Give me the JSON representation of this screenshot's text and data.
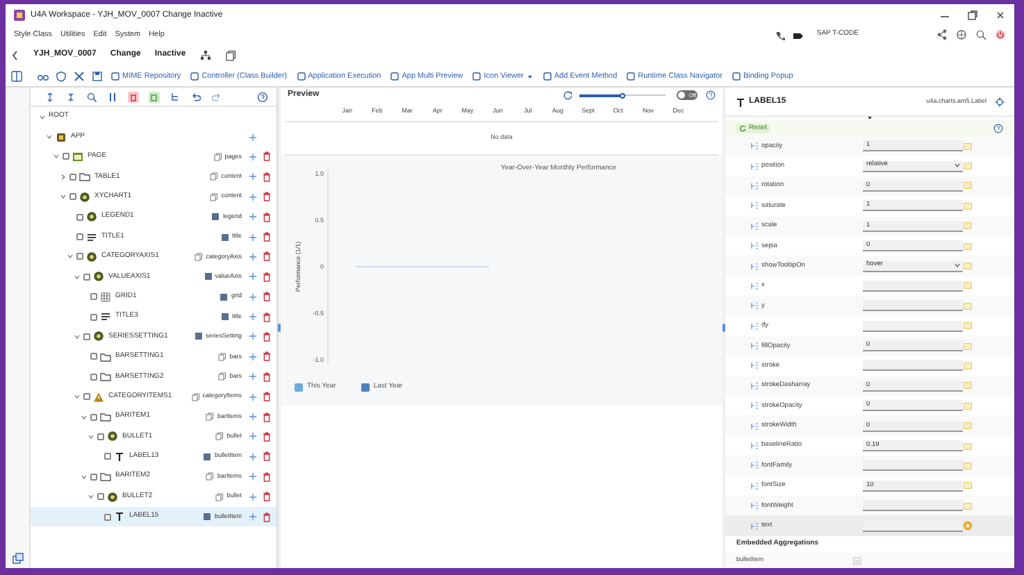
{
  "window": {
    "title": "U4A Workspace - YJH_MOV_0007 Change Inactive"
  },
  "menu": [
    "Style Class",
    "Utilities",
    "Edit",
    "System",
    "Help"
  ],
  "tcode": "SAP T-CODE",
  "app_header": {
    "name": "YJH_MOV_0007",
    "mode": "Change",
    "status": "Inactive"
  },
  "toolbar": [
    {
      "label": "MIME Repository"
    },
    {
      "label": "Controller (Class Builder)"
    },
    {
      "label": "Application Execution"
    },
    {
      "label": "App Multi Preview"
    },
    {
      "label": "Icon Viewer",
      "has_menu": true
    },
    {
      "label": "Add Event Method"
    },
    {
      "label": "Runtime Class Navigator"
    },
    {
      "label": "Binding Popup"
    }
  ],
  "tree": [
    {
      "label": "ROOT",
      "expanded": true,
      "addable": false,
      "deletable": false,
      "selected": false,
      "children": [
        {
          "label": "APP",
          "kind": "app",
          "expanded": true,
          "addable": true,
          "deletable": false,
          "selected": false,
          "children": [
            {
              "label": "PAGE",
              "kind": "page",
              "aggregation": "pages",
              "multiple": true,
              "expanded": true,
              "checked": false,
              "addable": true,
              "deletable": true,
              "selected": false,
              "children": [
                {
                  "label": "TABLE1",
                  "kind": "folder",
                  "aggregation": "content",
                  "multiple": true,
                  "expanded": false,
                  "checked": false,
                  "addable": true,
                  "deletable": true,
                  "selected": false
                },
                {
                  "label": "XYCHART1",
                  "kind": "chart",
                  "aggregation": "content",
                  "multiple": true,
                  "expanded": true,
                  "checked": false,
                  "addable": true,
                  "deletable": true,
                  "selected": false,
                  "children": [
                    {
                      "label": "LEGEND1",
                      "kind": "chart",
                      "aggregation": "legend",
                      "multiple": false,
                      "checked": false,
                      "addable": true,
                      "deletable": true,
                      "selected": false
                    },
                    {
                      "label": "TITLE1",
                      "kind": "title",
                      "aggregation": "title",
                      "multiple": false,
                      "checked": false,
                      "addable": true,
                      "deletable": true,
                      "selected": false
                    },
                    {
                      "label": "CATEGORYAXIS1",
                      "kind": "chart",
                      "aggregation": "categoryAxis",
                      "multiple": true,
                      "expanded": true,
                      "checked": false,
                      "addable": true,
                      "deletable": true,
                      "selected": false,
                      "children": [
                        {
                          "label": "VALUEAXIS1",
                          "kind": "chart",
                          "aggregation": "valueAxis",
                          "multiple": false,
                          "expanded": true,
                          "checked": false,
                          "addable": true,
                          "deletable": true,
                          "selected": false,
                          "children": [
                            {
                              "label": "GRID1",
                              "kind": "grid",
                              "aggregation": "grid",
                              "multiple": false,
                              "checked": false,
                              "addable": true,
                              "deletable": true,
                              "selected": false
                            },
                            {
                              "label": "TITLE3",
                              "kind": "title",
                              "aggregation": "title",
                              "multiple": false,
                              "checked": false,
                              "addable": true,
                              "deletable": true,
                              "selected": false
                            }
                          ]
                        },
                        {
                          "label": "SERIESSETTING1",
                          "kind": "chart",
                          "aggregation": "seriesSetting",
                          "multiple": false,
                          "expanded": true,
                          "checked": false,
                          "addable": true,
                          "deletable": true,
                          "selected": false,
                          "children": [
                            {
                              "label": "BARSETTING1",
                              "kind": "folder",
                              "aggregation": "bars",
                              "multiple": true,
                              "checked": false,
                              "addable": true,
                              "deletable": true,
                              "selected": false
                            },
                            {
                              "label": "BARSETTING2",
                              "kind": "folder",
                              "aggregation": "bars",
                              "multiple": true,
                              "checked": false,
                              "addable": true,
                              "deletable": true,
                              "selected": false
                            }
                          ]
                        },
                        {
                          "label": "CATEGORYITEMS1",
                          "kind": "warning",
                          "aggregation": "categoryItems",
                          "multiple": true,
                          "expanded": true,
                          "checked": false,
                          "addable": true,
                          "deletable": true,
                          "selected": false,
                          "children": [
                            {
                              "label": "BARITEM1",
                              "kind": "folder",
                              "aggregation": "barItems",
                              "multiple": true,
                              "expanded": true,
                              "checked": false,
                              "addable": true,
                              "deletable": true,
                              "selected": false,
                              "children": [
                                {
                                  "label": "BULLET1",
                                  "kind": "chart",
                                  "aggregation": "bullet",
                                  "multiple": true,
                                  "expanded": true,
                                  "checked": false,
                                  "addable": true,
                                  "deletable": true,
                                  "selected": false,
                                  "children": [
                                    {
                                      "label": "LABEL13",
                                      "kind": "label",
                                      "aggregation": "bulletItem",
                                      "multiple": false,
                                      "checked": false,
                                      "addable": true,
                                      "deletable": true,
                                      "selected": false
                                    }
                                  ]
                                }
                              ]
                            },
                            {
                              "label": "BARITEM2",
                              "kind": "folder",
                              "aggregation": "barItems",
                              "multiple": true,
                              "expanded": true,
                              "checked": false,
                              "addable": true,
                              "deletable": true,
                              "selected": false,
                              "children": [
                                {
                                  "label": "BULLET2",
                                  "kind": "chart",
                                  "aggregation": "bullet",
                                  "multiple": true,
                                  "expanded": true,
                                  "checked": false,
                                  "addable": true,
                                  "deletable": true,
                                  "selected": false,
                                  "children": [
                                    {
                                      "label": "LABEL15",
                                      "kind": "label",
                                      "aggregation": "bulletItem",
                                      "multiple": false,
                                      "checked": false,
                                      "addable": true,
                                      "deletable": true,
                                      "selected": true
                                    }
                                  ]
                                }
                              ]
                            }
                          ]
                        }
                      ]
                    }
                  ]
                }
              ]
            }
          ]
        }
      ]
    }
  ],
  "preview": {
    "title": "Preview",
    "slider": {
      "level": 0.5
    },
    "toggle": {
      "label": "Off",
      "on": false
    },
    "months": [
      "Jan",
      "Feb",
      "Mar",
      "Apr",
      "May",
      "Jun",
      "Jul",
      "Aug",
      "Sept",
      "Oct",
      "Nov",
      "Dec"
    ],
    "no_data": "No data",
    "chart": {
      "title": "Year-Over-Year Monthly Performance",
      "ylabel": "Performance (1/1)",
      "yticks": [
        "1.0",
        "0.5",
        "0",
        "-0.5",
        "-1.0"
      ],
      "legend": [
        {
          "name": "This Year",
          "color": "#6fa8dc"
        },
        {
          "name": "Last Year",
          "color": "#4f7fbf"
        }
      ]
    }
  },
  "properties": {
    "title": "LABEL15",
    "class_name": "u4a.charts.am5.Label",
    "reset": "Reset",
    "rows": [
      {
        "name": "opacity",
        "kind": "input",
        "value": "1",
        "selected": false
      },
      {
        "name": "position",
        "kind": "select",
        "value": "relative",
        "selected": false
      },
      {
        "name": "rotation",
        "kind": "input",
        "value": "0",
        "selected": false
      },
      {
        "name": "saturate",
        "kind": "input",
        "value": "1",
        "selected": false
      },
      {
        "name": "scale",
        "kind": "input",
        "value": "1",
        "selected": false
      },
      {
        "name": "sepia",
        "kind": "input",
        "value": "0",
        "selected": false
      },
      {
        "name": "showTooltipOn",
        "kind": "select",
        "value": "hover",
        "selected": false
      },
      {
        "name": "x",
        "kind": "input",
        "selected": false
      },
      {
        "name": "y",
        "kind": "input",
        "selected": false
      },
      {
        "name": "dy",
        "kind": "input",
        "selected": false
      },
      {
        "name": "fillOpacity",
        "kind": "input",
        "value": "0",
        "selected": false
      },
      {
        "name": "stroke",
        "kind": "input",
        "selected": false
      },
      {
        "name": "strokeDasharray",
        "kind": "input",
        "value": "0",
        "selected": false
      },
      {
        "name": "strokeOpacity",
        "kind": "input",
        "value": "0",
        "selected": false
      },
      {
        "name": "strokeWidth",
        "kind": "input",
        "value": "0",
        "selected": false
      },
      {
        "name": "baselineRatio",
        "kind": "input",
        "value": "0.19",
        "selected": false
      },
      {
        "name": "fontFamily",
        "kind": "input",
        "selected": false
      },
      {
        "name": "fontSize",
        "kind": "input",
        "value": "10",
        "selected": false
      },
      {
        "name": "fontWeight",
        "kind": "input",
        "selected": false
      },
      {
        "name": "text",
        "kind": "input",
        "selected": true
      }
    ],
    "embedded_title": "Embedded Aggregations",
    "embedded": [
      {
        "label": "bulletItem"
      }
    ]
  }
}
